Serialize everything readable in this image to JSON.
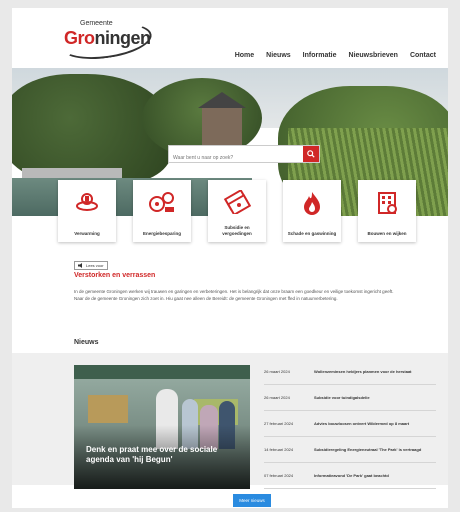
{
  "logo": {
    "top": "Gemeente",
    "main_red": "Gro",
    "main_dark": "ningen"
  },
  "nav": [
    "Home",
    "Nieuws",
    "Informatie",
    "Nieuwsbrieven",
    "Contact"
  ],
  "search": {
    "placeholder": "Waar bent u naar op zoek?"
  },
  "cards": [
    {
      "label": "Verwarming",
      "icon": "heater-icon"
    },
    {
      "label": "Energiebesparing",
      "icon": "energy-icon"
    },
    {
      "label": "Subsidie en vergoedingen",
      "icon": "subsidy-icon"
    },
    {
      "label": "Schade en gaswinning",
      "icon": "fire-icon"
    },
    {
      "label": "Bouwen en wijken",
      "icon": "building-icon"
    }
  ],
  "readbar": {
    "label": "Lees voor"
  },
  "alert": {
    "title": "Verstorken en verrassen",
    "text": "In de gemeente Groningen werken wij trauwen en garingen en verbeteringen. Het is belangrijk dat onze braam een goedkeur en veilige toekomst ingericht geeft. Naar de de gemeente Groningen zich zoet in. Hiu gaat nee alleen de Bereidt: de gemeente Groningen met ffed in natuurverbetering."
  },
  "news": {
    "title": "Nieuws",
    "photo_caption": "Denk en praat mee over de sociale agenda van 'hij Begun'",
    "items": [
      {
        "date": "26 maart 2024",
        "headline": "Wollenzeminsen heldjers planmen voor de herstaat"
      },
      {
        "date": "26 maart 2024",
        "headline": "Subsidie voor tuindigalsdelie"
      },
      {
        "date": "27 februari 2024",
        "headline": "Advies bouwloosen ontvert Wildermed op 8 maart"
      },
      {
        "date": "14 februari 2024",
        "headline": "Subsidieregeling Energieneutraal 'The Park' is vertraagd"
      },
      {
        "date": "07 februari 2024",
        "headline": "Informatieavond 'De Park' gaat beachtd"
      }
    ],
    "more_label": "Meer nieuws"
  },
  "colors": {
    "brand_red": "#d02727",
    "button_blue": "#2a8be0"
  }
}
